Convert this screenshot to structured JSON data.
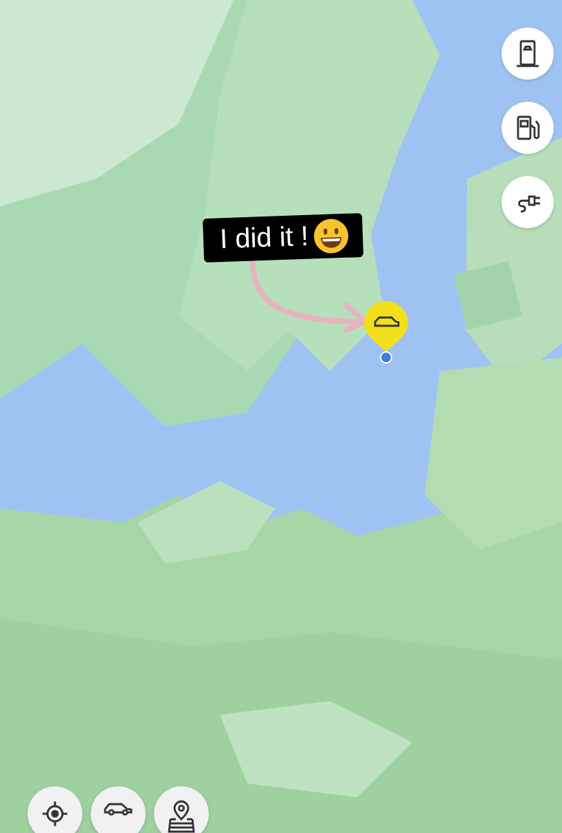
{
  "sticker": {
    "text": "I did it !"
  },
  "side_buttons": [
    {
      "kind": "charging-station"
    },
    {
      "kind": "fuel-pump"
    },
    {
      "kind": "plug"
    }
  ],
  "bottom_buttons": [
    {
      "kind": "locate"
    },
    {
      "kind": "car"
    },
    {
      "kind": "map-pin"
    }
  ]
}
